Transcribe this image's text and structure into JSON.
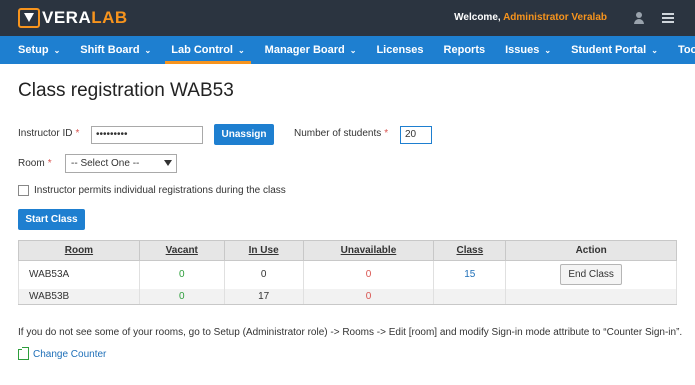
{
  "brand": {
    "part1": "VERA",
    "part2": "LAB"
  },
  "header": {
    "welcome": "Welcome,",
    "user": "Administrator Veralab"
  },
  "nav": [
    {
      "label": "Setup",
      "caret": "⌄"
    },
    {
      "label": "Shift Board",
      "caret": "⌄"
    },
    {
      "label": "Lab Control",
      "caret": "⌄",
      "active": true
    },
    {
      "label": "Manager Board",
      "caret": "⌄"
    },
    {
      "label": "Licenses"
    },
    {
      "label": "Reports"
    },
    {
      "label": "Issues",
      "caret": "⌄"
    },
    {
      "label": "Student Portal",
      "caret": "⌄"
    },
    {
      "label": "Tools",
      "caret": "⌄"
    }
  ],
  "page": {
    "title": "Class registration WAB53"
  },
  "form": {
    "instructor_label": "Instructor ID",
    "required_mark": "*",
    "instructor_value": "•••••••••",
    "unassign_label": "Unassign",
    "students_label": "Number of students",
    "students_value": "20",
    "room_label": "Room",
    "room_value": "-- Select One --",
    "permit_label": "Instructor permits individual registrations during the class",
    "start_label": "Start Class"
  },
  "table": {
    "headers": [
      "Room",
      "Vacant",
      "In Use",
      "Unavailable",
      "Class",
      "Action"
    ],
    "rows": [
      {
        "room": "WAB53A",
        "vacant": "0",
        "inuse": "0",
        "unavailable": "0",
        "class": "15",
        "action": "End Class"
      },
      {
        "room": "WAB53B",
        "vacant": "0",
        "inuse": "17",
        "unavailable": "0",
        "class": "",
        "action": ""
      }
    ]
  },
  "footer": {
    "note": "If you do not see some of your rooms, go to Setup (Administrator role) -> Rooms -> Edit [room] and modify Sign-in mode attribute to “Counter Sign-in”.",
    "change_counter": "Change Counter"
  }
}
